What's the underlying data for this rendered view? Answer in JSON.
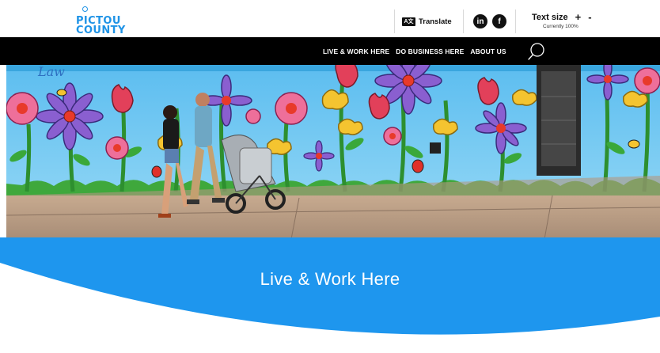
{
  "header": {
    "logo_line1": "PICTOU",
    "logo_line2": "COUNTY",
    "translate_icon": "A文",
    "translate_label": "Translate",
    "social": [
      {
        "name": "linkedin-icon",
        "glyph": "in"
      },
      {
        "name": "facebook-icon",
        "glyph": "f"
      }
    ],
    "text_size_label": "Text size",
    "text_size_increase": "+",
    "text_size_decrease": "-",
    "text_size_status": "Currently 100%"
  },
  "nav": {
    "items": [
      {
        "label": "LIVE & WORK HERE"
      },
      {
        "label": "DO BUSINESS HERE"
      },
      {
        "label": "ABOUT US"
      }
    ],
    "search_icon": "search-icon"
  },
  "hero": {
    "mural_text": "Law"
  },
  "banner": {
    "title": "Live & Work Here"
  },
  "colors": {
    "brand_blue": "#1f93e6",
    "nav_bg": "#000000",
    "banner_blue": "#1e96ee"
  }
}
